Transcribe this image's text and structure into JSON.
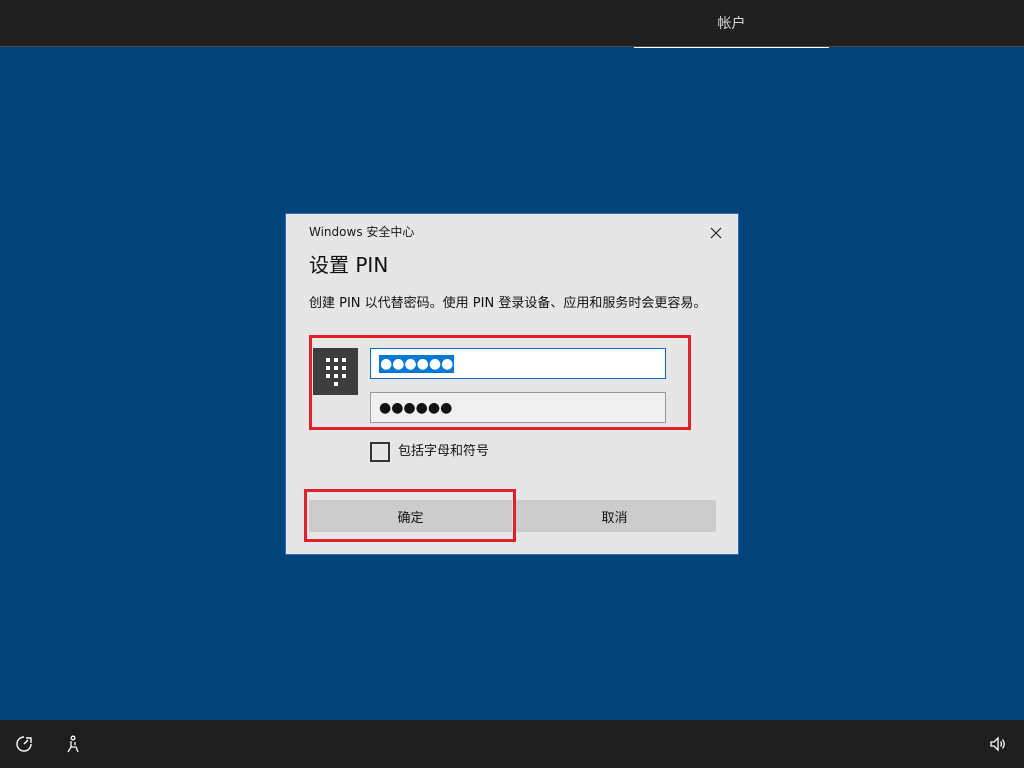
{
  "topbar": {
    "tab_label": "帐户"
  },
  "dialog": {
    "caption": "Windows 安全中心",
    "title": "设置 PIN",
    "description": "创建 PIN 以代替密码。使用 PIN 登录设备、应用和服务时会更容易。",
    "pin_value": "●●●●●●",
    "confirm_pin_value": "●●●●●●",
    "checkbox_label": "包括字母和符号",
    "checkbox_checked": false,
    "ok_label": "确定",
    "cancel_label": "取消",
    "icons": {
      "close": "close-icon",
      "keypad": "keypad-icon"
    }
  },
  "bottombar": {
    "icons": [
      "ease-of-access-icon",
      "accessibility-icon",
      "volume-icon"
    ]
  },
  "colors": {
    "background": "#00447a",
    "dialog": "#e6e6e6",
    "accent": "#0078d7",
    "highlight": "#e3202a"
  }
}
